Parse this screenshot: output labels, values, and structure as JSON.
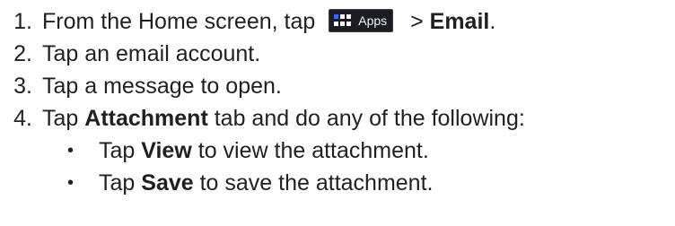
{
  "steps": [
    {
      "number": "1.",
      "text_before": "From the Home screen, tap ",
      "chip_label": "Apps",
      "text_mid": " > ",
      "bold": "Email",
      "text_after": "."
    },
    {
      "number": "2.",
      "text": "Tap an email account."
    },
    {
      "number": "3.",
      "text": "Tap a message to open."
    },
    {
      "number": "4.",
      "text_before": "Tap ",
      "bold": "Attachment",
      "text_after": " tab and do any of the following:"
    }
  ],
  "substeps": [
    {
      "bullet": "•",
      "text_before": "Tap ",
      "bold": "View",
      "text_after": " to view the attachment."
    },
    {
      "bullet": "•",
      "text_before": "Tap ",
      "bold": "Save",
      "text_after": " to save the attachment."
    }
  ],
  "colors": {
    "text": "#231f20",
    "apps_chip_bg": "#1b1d22",
    "apps_grid_blue": "#2f6df6"
  },
  "icons": {
    "apps": "apps-grid-icon"
  }
}
